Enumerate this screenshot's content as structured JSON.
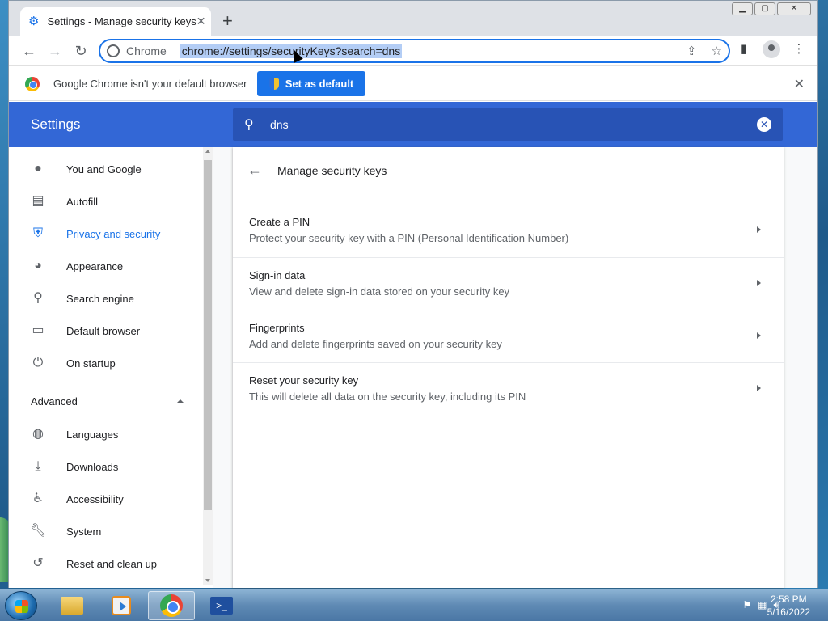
{
  "browser": {
    "tab_title": "Settings - Manage security keys",
    "new_tab": "+",
    "omnibox": {
      "chip": "Chrome",
      "url": "chrome://settings/securityKeys?search=dns"
    }
  },
  "infobar": {
    "message": "Google Chrome isn't your default browser",
    "set_default_label": "Set as default"
  },
  "settings": {
    "title": "Settings",
    "search_value": "dns",
    "nav": [
      {
        "label": "You and Google",
        "icon": "person-icon"
      },
      {
        "label": "Autofill",
        "icon": "clipboard-icon"
      },
      {
        "label": "Privacy and security",
        "icon": "shield-icon"
      },
      {
        "label": "Appearance",
        "icon": "palette-icon"
      },
      {
        "label": "Search engine",
        "icon": "search-icon"
      },
      {
        "label": "Default browser",
        "icon": "browser-icon"
      },
      {
        "label": "On startup",
        "icon": "power-icon"
      }
    ],
    "advanced_label": "Advanced",
    "advanced_nav": [
      {
        "label": "Languages",
        "icon": "globe-icon"
      },
      {
        "label": "Downloads",
        "icon": "download-icon"
      },
      {
        "label": "Accessibility",
        "icon": "accessibility-icon"
      },
      {
        "label": "System",
        "icon": "wrench-icon"
      },
      {
        "label": "Reset and clean up",
        "icon": "restore-icon"
      }
    ]
  },
  "page": {
    "title": "Manage security keys",
    "rows": [
      {
        "title": "Create a PIN",
        "subtitle": "Protect your security key with a PIN (Personal Identification Number)"
      },
      {
        "title": "Sign-in data",
        "subtitle": "View and delete sign-in data stored on your security key"
      },
      {
        "title": "Fingerprints",
        "subtitle": "Add and delete fingerprints saved on your security key"
      },
      {
        "title": "Reset your security key",
        "subtitle": "This will delete all data on the security key, including its PIN"
      }
    ]
  },
  "taskbar": {
    "time": "2:58 PM",
    "date": "5/16/2022"
  }
}
